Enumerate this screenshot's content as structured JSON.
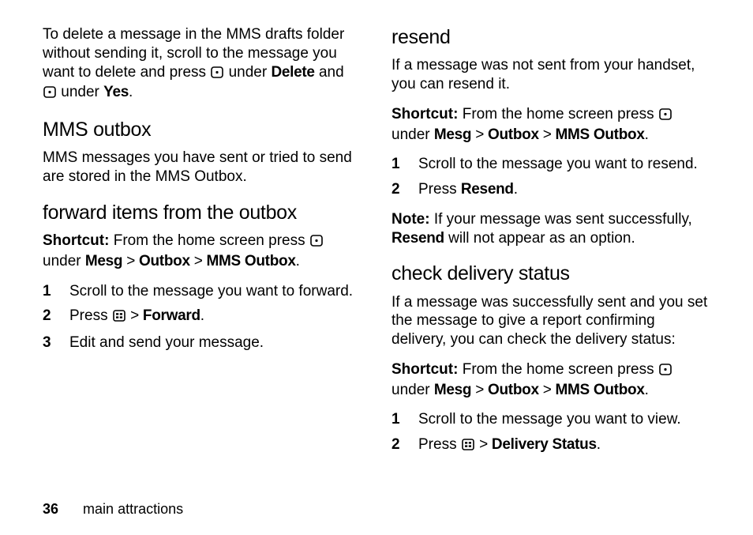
{
  "left": {
    "intro": {
      "t1": "To delete a message in the MMS drafts folder without sending it, scroll to the message you want to delete and press ",
      "t2": " under ",
      "b1": "Delete",
      "t3": " and ",
      "t4": " under ",
      "b2": "Yes",
      "t5": "."
    },
    "h_outbox": "MMS outbox",
    "outbox_para": "MMS messages you have sent or tried to send are stored in the MMS Outbox.",
    "h_forward": "forward items from the outbox",
    "shortcut": {
      "lbl": "Shortcut:",
      "t1": " From the home screen press ",
      "t2": " under ",
      "p1": "Mesg",
      "gt1": " > ",
      "p2": "Outbox",
      "gt2": " > ",
      "p3": "MMS Outbox",
      "t3": "."
    },
    "steps": {
      "s1": "Scroll to the message you want to forward.",
      "s2a": "Press ",
      "s2b": " > ",
      "s2c": "Forward",
      "s2d": ".",
      "s3": "Edit and send your message."
    }
  },
  "right": {
    "h_resend": "resend",
    "resend_para": "If a message was not sent from your handset, you can resend it.",
    "shortcut": {
      "lbl": "Shortcut:",
      "t1": " From the home screen press ",
      "t2": " under ",
      "p1": "Mesg",
      "gt1": " > ",
      "p2": "Outbox",
      "gt2": " > ",
      "p3": "MMS Outbox",
      "t3": "."
    },
    "steps1": {
      "s1": "Scroll to the message you want to resend.",
      "s2a": "Press ",
      "s2b": "Resend",
      "s2c": "."
    },
    "note": {
      "lbl": "Note:",
      "t1": " If your message was sent successfully, ",
      "b1": "Resend",
      "t2": " will not appear as an option."
    },
    "h_check": "check delivery status",
    "check_para": "If a message was successfully sent and you set the message to give a report confirming delivery, you can check the delivery status:",
    "shortcut2": {
      "lbl": "Shortcut:",
      "t1": " From the home screen press ",
      "t2": " under ",
      "p1": "Mesg",
      "gt1": " > ",
      "p2": "Outbox",
      "gt2": " > ",
      "p3": "MMS Outbox",
      "t3": "."
    },
    "steps2": {
      "s1": "Scroll to the message you want to view.",
      "s2a": "Press ",
      "s2b": " > ",
      "s2c": "Delivery Status",
      "s2d": "."
    }
  },
  "footer": {
    "page": "36",
    "title": "main attractions"
  },
  "nums": {
    "n1": "1",
    "n2": "2",
    "n3": "3"
  }
}
